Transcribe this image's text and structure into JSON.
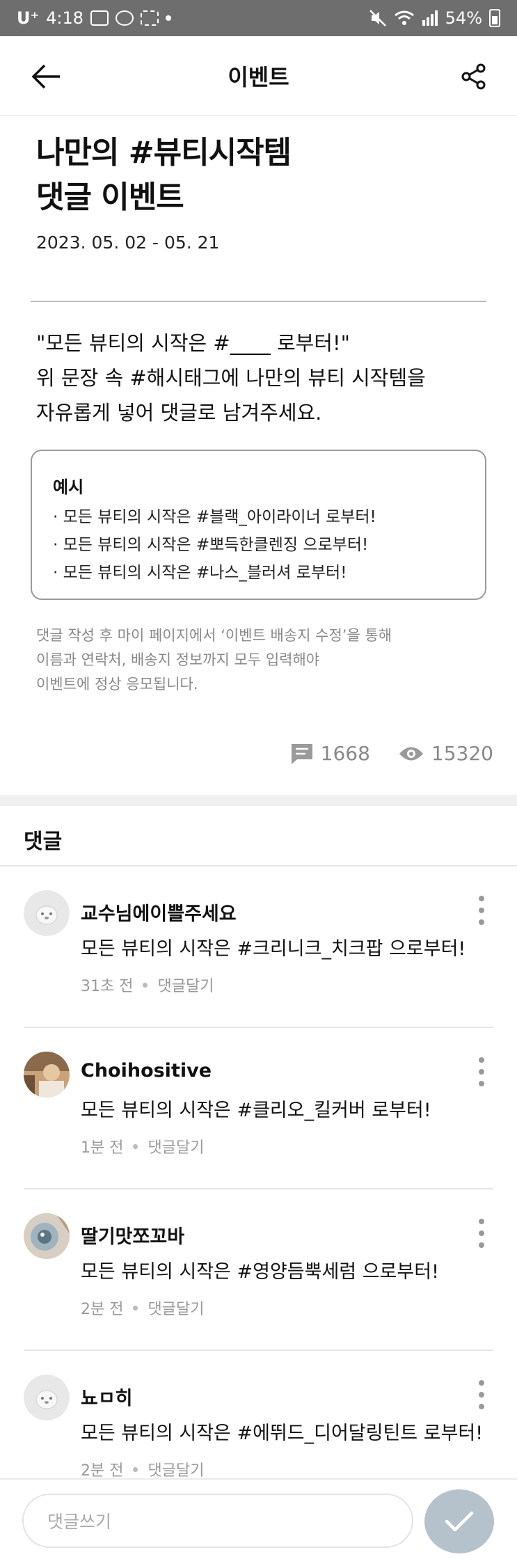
{
  "status_bar": {
    "carrier": "U⁺",
    "time": "4:18",
    "battery": "54%"
  },
  "header": {
    "title": "이벤트"
  },
  "event": {
    "title_line1": "나만의 #뷰티시작템",
    "title_line2": "댓글 이벤트",
    "date": "2023. 05. 02  -  05. 21",
    "desc_line1": "\"모든 뷰티의 시작은 #____ 로부터!\"",
    "desc_line2": "위 문장 속 #해시태그에 나만의 뷰티 시작템을",
    "desc_line3": "자유롭게 넣어 댓글로 남겨주세요.",
    "example_title": "예시",
    "examples": [
      "· 모든 뷰티의 시작은 #블랙_아이라이너 로부터!",
      "· 모든 뷰티의 시작은 #뽀득한클렌징 으로부터!",
      "· 모든 뷰티의 시작은 #나스_블러셔 로부터!"
    ],
    "notice_line1": "댓글 작성 후 마이 페이지에서 ‘이벤트 배송지 수정’을 통해",
    "notice_line2": "이름과 연락처, 배송지 정보까지 모두 입력해야",
    "notice_line3": "이벤트에 정상 응모됩니다.",
    "comment_count": "1668",
    "view_count": "15320"
  },
  "comments_section": {
    "title": "댓글",
    "reply_label": "댓글달기",
    "items": [
      {
        "name": "교수님에이쁠주세요",
        "text": "모든 뷰티의 시작은 #크리니크_치크팝 으로부터!",
        "time": "31초 전"
      },
      {
        "name": "Choihositive",
        "text": "모든 뷰티의 시작은 #클리오_킬커버 로부터!",
        "time": "1분 전"
      },
      {
        "name": "딸기맛쪼꼬바",
        "text": "모든 뷰티의 시작은 #영양듬뿍세럼 으로부터!",
        "time": "2분 전"
      },
      {
        "name": "뇨ㅁ히",
        "text": "모든 뷰티의 시작은 #에뛰드_디어달링틴트 로부터!",
        "time": "2분 전"
      }
    ]
  },
  "input_bar": {
    "placeholder": "댓글쓰기"
  }
}
